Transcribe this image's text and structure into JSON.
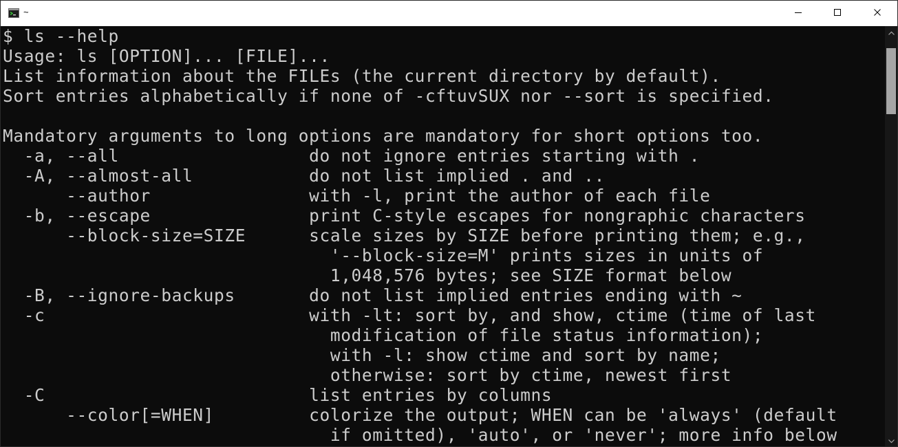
{
  "window": {
    "title": "~",
    "icons": {
      "app": "terminal-icon",
      "minimize": "minimize-icon",
      "maximize": "maximize-icon",
      "close": "close-icon"
    }
  },
  "terminal": {
    "lines": [
      "$ ls --help",
      "Usage: ls [OPTION]... [FILE]...",
      "List information about the FILEs (the current directory by default).",
      "Sort entries alphabetically if none of -cftuvSUX nor --sort is specified.",
      "",
      "Mandatory arguments to long options are mandatory for short options too.",
      "  -a, --all                  do not ignore entries starting with .",
      "  -A, --almost-all           do not list implied . and ..",
      "      --author               with -l, print the author of each file",
      "  -b, --escape               print C-style escapes for nongraphic characters",
      "      --block-size=SIZE      scale sizes by SIZE before printing them; e.g.,",
      "                               '--block-size=M' prints sizes in units of",
      "                               1,048,576 bytes; see SIZE format below",
      "  -B, --ignore-backups       do not list implied entries ending with ~",
      "  -c                         with -lt: sort by, and show, ctime (time of last",
      "                               modification of file status information);",
      "                               with -l: show ctime and sort by name;",
      "                               otherwise: sort by ctime, newest first",
      "  -C                         list entries by columns",
      "      --color[=WHEN]         colorize the output; WHEN can be 'always' (default",
      "                               if omitted), 'auto', or 'never'; more info below"
    ]
  },
  "colors": {
    "titlebar": "#ffffff",
    "background": "#0c0c0c",
    "text": "#cccccc",
    "scroll_track": "#171717",
    "scroll_thumb": "#a6a6a6"
  }
}
